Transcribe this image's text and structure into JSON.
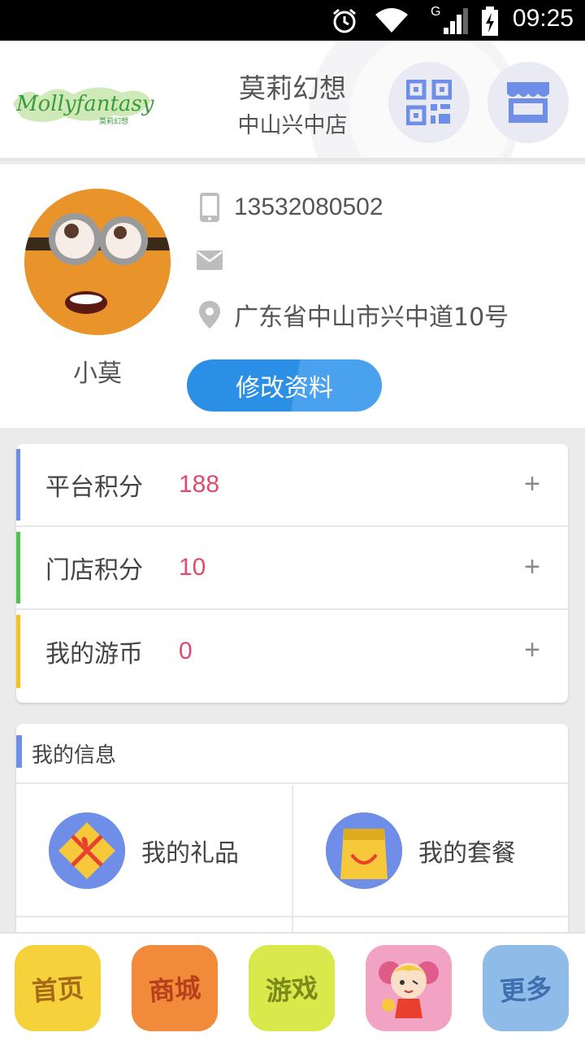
{
  "status_bar": {
    "time": "09:25",
    "network": "G"
  },
  "header": {
    "logo_text": "Mollyfantasy",
    "logo_sub": "莫莉幻想",
    "store_name": "莫莉幻想",
    "store_branch": "中山兴中店"
  },
  "profile": {
    "nickname": "小莫",
    "phone": "13532080502",
    "email": "",
    "address": "广东省中山市兴中道10号",
    "edit_label": "修改资料"
  },
  "points": [
    {
      "label": "平台积分",
      "value": "188",
      "plus": "+",
      "color": "#6f8ee8"
    },
    {
      "label": "门店积分",
      "value": "10",
      "plus": "+",
      "color": "#4fc24f"
    },
    {
      "label": "我的游币",
      "value": "0",
      "plus": "+",
      "color": "#f6c21e"
    }
  ],
  "my_info": {
    "title": "我的信息",
    "items": [
      {
        "label": "我的礼品",
        "icon": "gift-icon"
      },
      {
        "label": "我的套餐",
        "icon": "bag-icon"
      }
    ]
  },
  "bottom_nav": [
    {
      "label": "首页",
      "bg": "#f5d23c",
      "fg": "#a66a16"
    },
    {
      "label": "商城",
      "bg": "#f28a3c",
      "fg": "#b5401b"
    },
    {
      "label": "游戏",
      "bg": "#d9e84a",
      "fg": "#7a8a1a"
    },
    {
      "label": "",
      "bg": "#f2a3c4",
      "fg": "#c23a6e",
      "icon": "mascot-icon"
    },
    {
      "label": "更多",
      "bg": "#8fbbe8",
      "fg": "#3f6fae"
    }
  ]
}
